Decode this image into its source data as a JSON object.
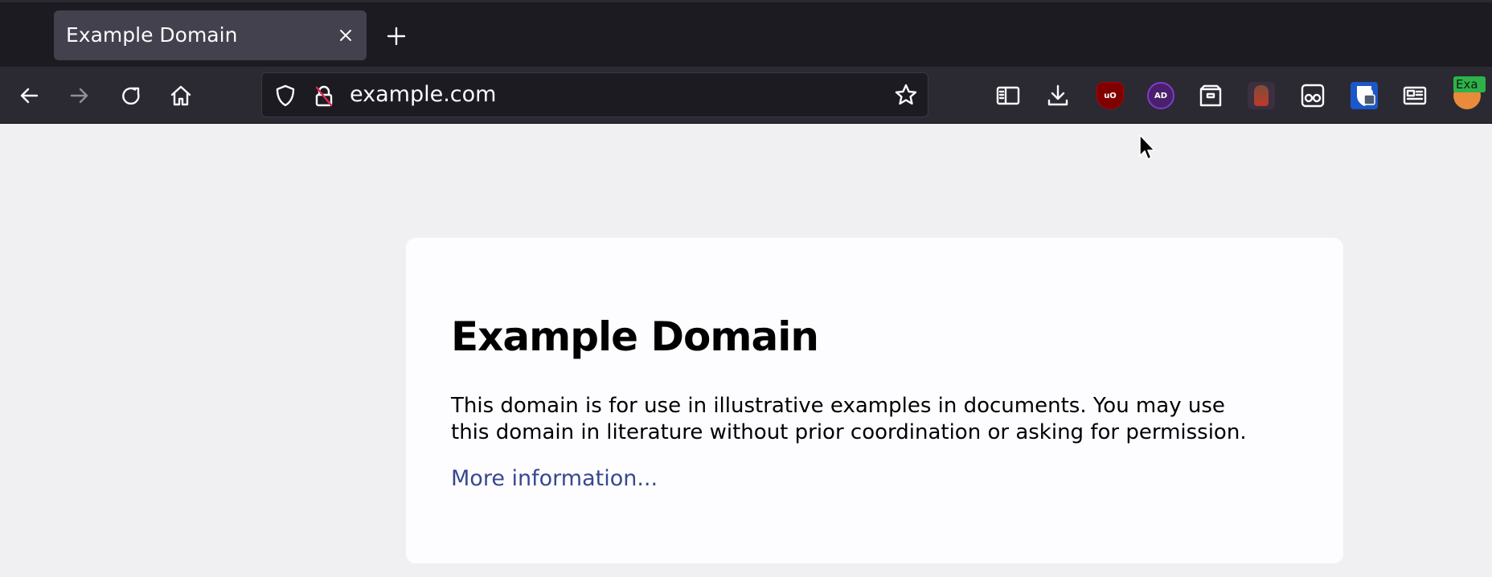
{
  "browser": {
    "tab": {
      "title": "Example Domain",
      "close_icon": "close-icon"
    },
    "new_tab_icon": "plus-icon",
    "nav": {
      "back_icon": "arrow-left-icon",
      "forward_icon": "arrow-right-icon",
      "reload_icon": "reload-icon",
      "home_icon": "home-icon"
    },
    "urlbar": {
      "shield_icon": "shield-icon",
      "lock_icon": "insecure-lock-icon",
      "url": "example.com",
      "star_icon": "star-icon"
    },
    "toolbar_icons": [
      "reader-view-icon",
      "download-icon",
      "ublock-origin-icon",
      "adguard-icon",
      "container-icon",
      "monster-extension-icon",
      "glasses-icon",
      "bitwarden-icon",
      "reader-icon",
      "avatar-icon"
    ],
    "extensions": {
      "ublock_label": "uO",
      "adguard_label": "AD",
      "avatar_label": "Exa"
    },
    "colors": {
      "chrome": "#1c1b22",
      "toolbar": "#2b2a33",
      "accent_link": "#38488f"
    }
  },
  "page": {
    "heading": "Example Domain",
    "paragraph": "This domain is for use in illustrative examples in documents. You may use this domain in literature without prior coordination or asking for permission.",
    "link_text": "More information..."
  }
}
